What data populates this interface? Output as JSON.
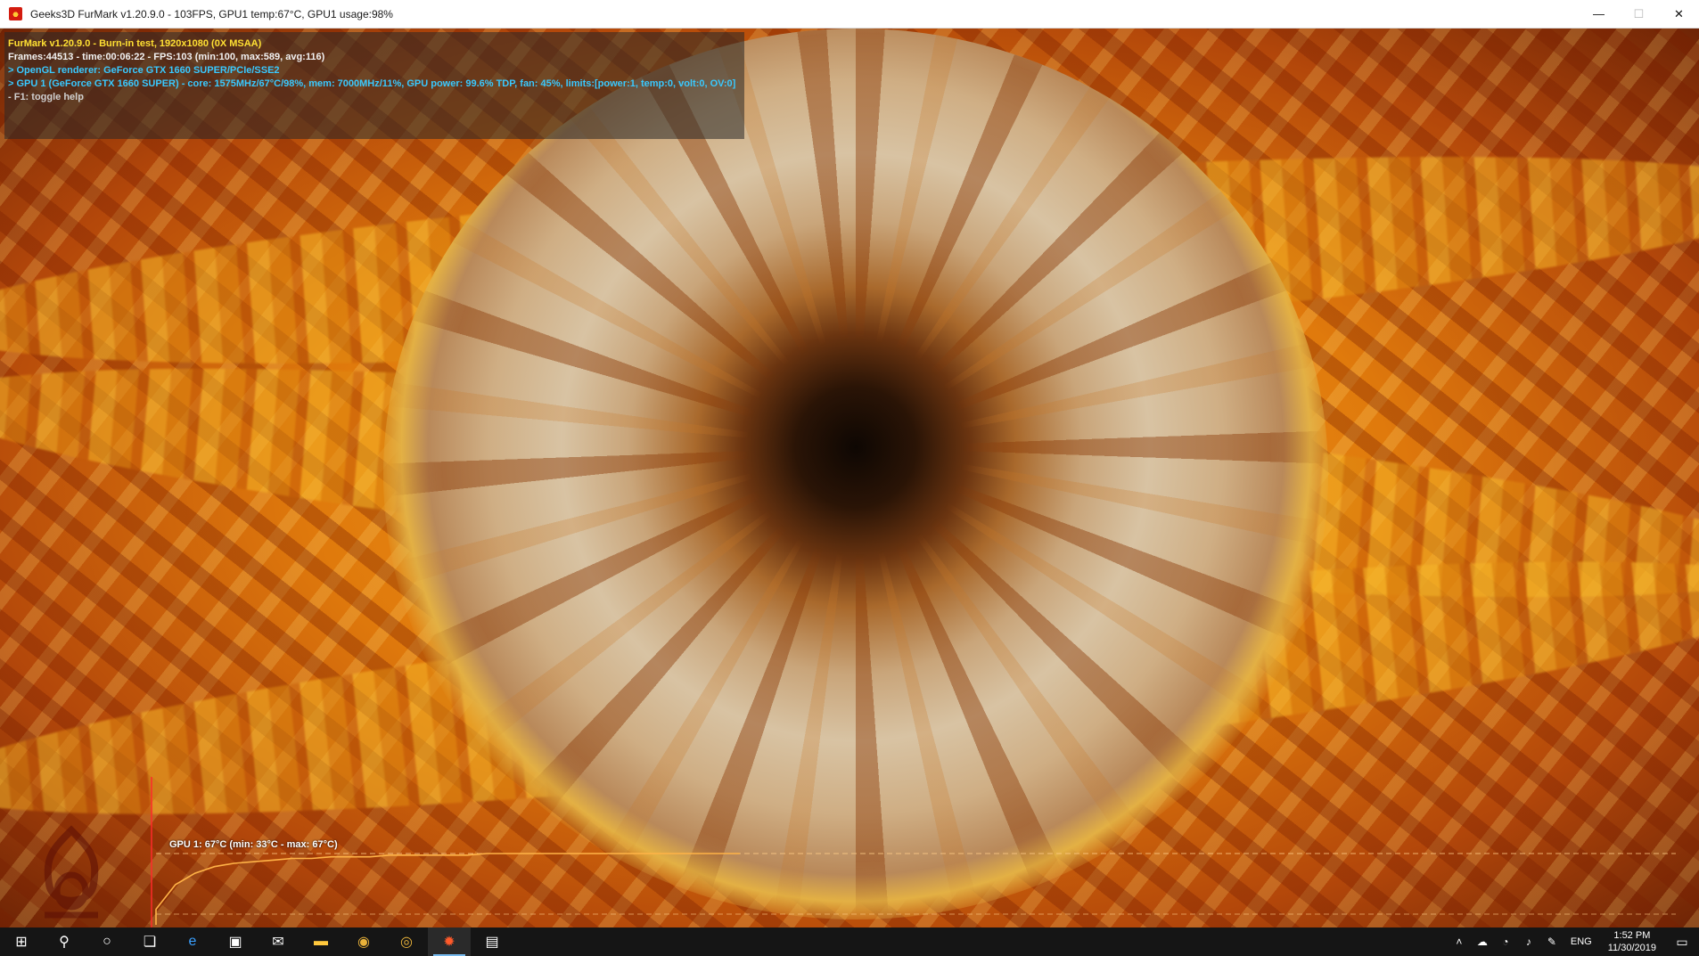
{
  "window": {
    "title": "Geeks3D FurMark v1.20.9.0 - 103FPS, GPU1 temp:67°C, GPU1 usage:98%",
    "controls": {
      "minimize": "—",
      "maximize": "☐",
      "close": "✕"
    }
  },
  "osd": {
    "line1": "FurMark v1.20.9.0 - Burn-in test, 1920x1080 (0X MSAA)",
    "line2": "Frames:44513 - time:00:06:22 - FPS:103 (min:100, max:589, avg:116)",
    "line3": "> OpenGL renderer: GeForce GTX 1660 SUPER/PCIe/SSE2",
    "line4": "> GPU 1 (GeForce GTX 1660 SUPER) - core: 1575MHz/67°C/98%, mem: 7000MHz/11%, GPU power: 99.6% TDP, fan: 45%, limits:[power:1, temp:0, volt:0, OV:0]",
    "line5": "- F1: toggle help"
  },
  "temperature_graph": {
    "label": "GPU 1: 67°C (min: 33°C - max: 67°C)",
    "line_color": "#ffb347",
    "min_c": 33,
    "max_c": 67,
    "current_c": 67,
    "samples": [
      33,
      48,
      55,
      59,
      61,
      62,
      63,
      64,
      64,
      65,
      65,
      65,
      66,
      66,
      66,
      66,
      66,
      67,
      67,
      67,
      67,
      67,
      67,
      67,
      67,
      67,
      67,
      67,
      67,
      67,
      67
    ]
  },
  "taskbar": {
    "items": [
      {
        "icon": "windows-start-icon",
        "glyph": "⊞"
      },
      {
        "icon": "search-icon",
        "glyph": "⚲"
      },
      {
        "icon": "cortana-icon",
        "glyph": "○"
      },
      {
        "icon": "task-view-icon",
        "glyph": "❏"
      },
      {
        "icon": "edge-icon",
        "glyph": "e"
      },
      {
        "icon": "store-icon",
        "glyph": "▣"
      },
      {
        "icon": "mail-icon",
        "glyph": "✉"
      },
      {
        "icon": "file-explorer-icon",
        "glyph": "▬"
      },
      {
        "icon": "chrome-icon",
        "glyph": "◉"
      },
      {
        "icon": "chrome-profile-icon",
        "glyph": "◎"
      },
      {
        "icon": "furmark-icon",
        "glyph": "✹"
      },
      {
        "icon": "app-window-icon",
        "glyph": "▤"
      }
    ],
    "tray": {
      "language": "ENG",
      "time": "1:52 PM",
      "date": "11/30/2019"
    }
  }
}
